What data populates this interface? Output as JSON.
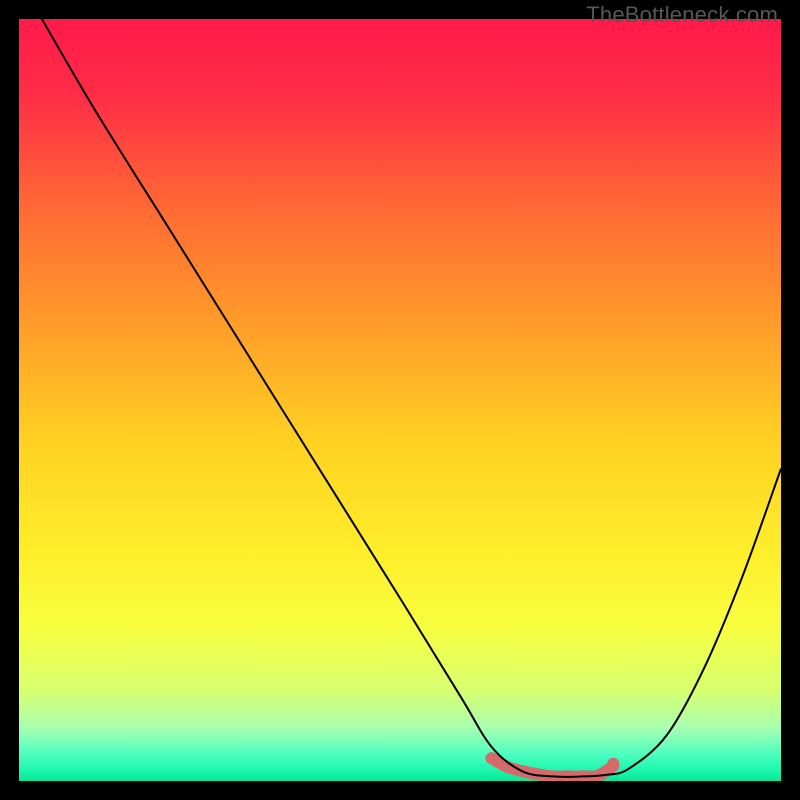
{
  "watermark": "TheBottleneck.com",
  "chart_data": {
    "type": "line",
    "title": "",
    "xlabel": "",
    "ylabel": "",
    "xlim": [
      0,
      100
    ],
    "ylim": [
      0,
      100
    ],
    "grid": false,
    "background_gradient": {
      "stops": [
        {
          "offset": 0.0,
          "color": "#ff1a4a"
        },
        {
          "offset": 0.1,
          "color": "#ff2d46"
        },
        {
          "offset": 0.25,
          "color": "#ff6a34"
        },
        {
          "offset": 0.4,
          "color": "#ff9c2a"
        },
        {
          "offset": 0.55,
          "color": "#ffd022"
        },
        {
          "offset": 0.7,
          "color": "#ffee2a"
        },
        {
          "offset": 0.8,
          "color": "#f7ff40"
        },
        {
          "offset": 0.88,
          "color": "#d8ff70"
        },
        {
          "offset": 0.93,
          "color": "#a8ffb0"
        },
        {
          "offset": 0.965,
          "color": "#4dffc0"
        },
        {
          "offset": 0.985,
          "color": "#1df7b0"
        },
        {
          "offset": 1.0,
          "color": "#08e698"
        }
      ]
    },
    "series": [
      {
        "name": "bottleneck-curve",
        "color": "#000000",
        "width": 2,
        "x": [
          3.0,
          10.0,
          20.0,
          30.0,
          40.0,
          50.0,
          58.0,
          62.0,
          66.0,
          70.0,
          74.0,
          77.0,
          80.0,
          85.0,
          90.0,
          95.0,
          100.0
        ],
        "y": [
          100.0,
          88.0,
          72.0,
          56.0,
          40.0,
          24.0,
          11.0,
          4.5,
          1.3,
          0.6,
          0.6,
          0.8,
          1.6,
          6.0,
          15.0,
          27.0,
          41.0
        ]
      }
    ],
    "highlight": {
      "name": "optimal-range",
      "color": "#d66a6a",
      "radius": 6,
      "x": [
        62.0,
        64.0,
        66.0,
        68.0,
        70.0,
        72.0,
        74.0,
        76.0,
        78.0
      ],
      "y": [
        3.0,
        1.9,
        1.3,
        0.9,
        0.6,
        0.6,
        0.6,
        0.7,
        2.0
      ]
    }
  }
}
